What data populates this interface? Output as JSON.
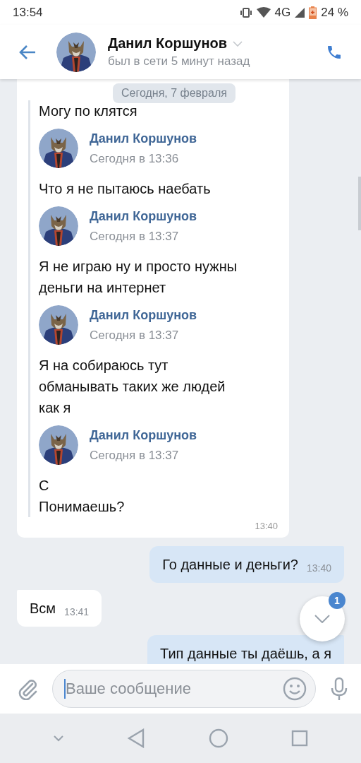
{
  "status_bar": {
    "time": "13:54",
    "network": "4G",
    "battery": "24 %"
  },
  "header": {
    "name": "Данил Коршунов",
    "status": "был в сети 5 минут назад"
  },
  "date_pill": "Сегодня, 7 февраля",
  "messages": [
    {
      "kind": "forwarded",
      "time": "13:40",
      "items": [
        {
          "text": "Могу по клятся"
        },
        {
          "author": "Данил Коршунов",
          "time": "Сегодня в 13:36",
          "text": "Что я не пытаюсь наебать"
        },
        {
          "author": "Данил Коршунов",
          "time": "Сегодня в 13:37",
          "text": "Я не играю ну и просто нужны\nденьги на интернет"
        },
        {
          "author": "Данил Коршунов",
          "time": "Сегодня в 13:37",
          "text": "Я на собираюсь тут\nобманывать таких же людей\nкак я"
        },
        {
          "author": "Данил Коршунов",
          "time": "Сегодня в 13:37",
          "text": "С\nПонимаешь?"
        }
      ]
    },
    {
      "kind": "outgoing",
      "text": "Го данные и деньги?",
      "time": "13:40"
    },
    {
      "kind": "incoming",
      "text": "Всм",
      "time": "13:41"
    },
    {
      "kind": "outgoing",
      "text": "Тип данные ты даёшь, а я"
    }
  ],
  "scroll_button": {
    "badge": "1"
  },
  "composer": {
    "placeholder": "Ваше сообщение"
  }
}
